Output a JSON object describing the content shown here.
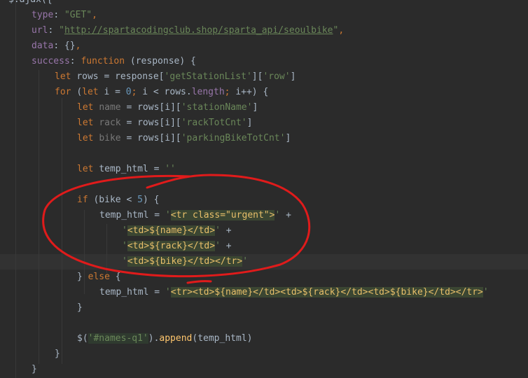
{
  "editor": {
    "lines": [
      {
        "tokens": [
          [
            "$.ajax({",
            "t-plain"
          ]
        ]
      },
      {
        "tokens": [
          [
            "type",
            "t-prop"
          ],
          [
            ": ",
            "t-plain"
          ],
          [
            "\"GET\"",
            "t-str"
          ],
          [
            ",",
            "t-kw"
          ]
        ]
      },
      {
        "tokens": [
          [
            "url",
            "t-prop"
          ],
          [
            ": ",
            "t-plain"
          ],
          [
            "\"",
            "t-str"
          ],
          [
            "http://spartacodingclub.shop/sparta_api/seoulbike",
            "t-url"
          ],
          [
            "\"",
            "t-str"
          ],
          [
            ",",
            "t-kw"
          ]
        ]
      },
      {
        "tokens": [
          [
            "data",
            "t-prop"
          ],
          [
            ": {}",
            "t-plain"
          ],
          [
            ",",
            "t-kw"
          ]
        ]
      },
      {
        "tokens": [
          [
            "success",
            "t-prop"
          ],
          [
            ": ",
            "t-plain"
          ],
          [
            "function",
            "t-kw"
          ],
          [
            " (response) {",
            "t-plain"
          ]
        ]
      },
      {
        "tokens": [
          [
            "let ",
            "t-kw"
          ],
          [
            "rows = response[",
            "t-plain"
          ],
          [
            "'getStationList'",
            "t-str"
          ],
          [
            "][",
            "t-plain"
          ],
          [
            "'row'",
            "t-str"
          ],
          [
            "]",
            "t-plain"
          ]
        ]
      },
      {
        "tokens": [
          [
            "for ",
            "t-kw"
          ],
          [
            "(",
            "t-plain"
          ],
          [
            "let ",
            "t-kw"
          ],
          [
            "i = ",
            "t-plain"
          ],
          [
            "0",
            "t-num"
          ],
          [
            "; ",
            "t-kw"
          ],
          [
            "i < rows.",
            "t-plain"
          ],
          [
            "length",
            "t-prop"
          ],
          [
            "; ",
            "t-kw"
          ],
          [
            "i++) {",
            "t-plain"
          ]
        ]
      },
      {
        "tokens": [
          [
            "let ",
            "t-kw"
          ],
          [
            "name",
            "t-muted"
          ],
          [
            " = rows[i][",
            "t-plain"
          ],
          [
            "'stationName'",
            "t-str"
          ],
          [
            "]",
            "t-plain"
          ]
        ]
      },
      {
        "tokens": [
          [
            "let ",
            "t-kw"
          ],
          [
            "rack",
            "t-muted"
          ],
          [
            " = rows[i][",
            "t-plain"
          ],
          [
            "'rackTotCnt'",
            "t-str"
          ],
          [
            "]",
            "t-plain"
          ]
        ]
      },
      {
        "tokens": [
          [
            "let ",
            "t-kw"
          ],
          [
            "bike",
            "t-muted"
          ],
          [
            " = rows[i][",
            "t-plain"
          ],
          [
            "'parkingBikeTotCnt'",
            "t-str"
          ],
          [
            "]",
            "t-plain"
          ]
        ]
      },
      {
        "tokens": []
      },
      {
        "tokens": [
          [
            "let ",
            "t-kw"
          ],
          [
            "temp_html = ",
            "t-plain"
          ],
          [
            "''",
            "t-str"
          ]
        ]
      },
      {
        "tokens": []
      },
      {
        "tokens": [
          [
            "if ",
            "t-kw"
          ],
          [
            "(bike < ",
            "t-plain"
          ],
          [
            "5",
            "t-num"
          ],
          [
            ") {",
            "t-plain"
          ]
        ]
      },
      {
        "tokens": [
          [
            "temp_html = ",
            "t-plain"
          ],
          [
            "'",
            "t-str"
          ],
          [
            "<tr class=\"urgent\">",
            "t-html-hl"
          ],
          [
            "'",
            "t-str"
          ],
          [
            " +",
            "t-plain"
          ]
        ]
      },
      {
        "tokens": [
          [
            "'",
            "t-str"
          ],
          [
            "<td>${name}</td>",
            "t-html-hl"
          ],
          [
            "'",
            "t-str"
          ],
          [
            " +",
            "t-plain"
          ]
        ]
      },
      {
        "tokens": [
          [
            "'",
            "t-str"
          ],
          [
            "<td>${rack}</td>",
            "t-html-hl"
          ],
          [
            "'",
            "t-str"
          ],
          [
            " +",
            "t-plain"
          ]
        ]
      },
      {
        "tokens": [
          [
            "'",
            "t-str"
          ],
          [
            "<td>${bike}</td></tr>",
            "t-html-hl"
          ],
          [
            "'",
            "t-str"
          ]
        ]
      },
      {
        "tokens": [
          [
            "} ",
            "t-plain"
          ],
          [
            "else ",
            "t-kw"
          ],
          [
            "{",
            "t-plain"
          ]
        ]
      },
      {
        "tokens": [
          [
            "temp_html = ",
            "t-plain"
          ],
          [
            "'",
            "t-str"
          ],
          [
            "<tr><td>${name}</td><td>${rack}</td><td>${bike}</td></tr>",
            "t-html-hl"
          ],
          [
            "'",
            "t-str"
          ]
        ]
      },
      {
        "tokens": [
          [
            "}",
            "t-plain"
          ]
        ]
      },
      {
        "tokens": []
      },
      {
        "tokens": [
          [
            "$(",
            "t-plain"
          ],
          [
            "'#names-q1'",
            "t-str-hl"
          ],
          [
            ").",
            "t-plain"
          ],
          [
            "append",
            "t-fn"
          ],
          [
            "(temp_html)",
            "t-plain"
          ]
        ]
      },
      {
        "tokens": [
          [
            "}",
            "t-plain"
          ]
        ]
      },
      {
        "tokens": [
          [
            "}",
            "t-plain"
          ]
        ]
      }
    ]
  },
  "colors": {
    "background": "#2b2b2b",
    "keyword": "#cc7832",
    "string": "#6a8759",
    "property": "#9876aa",
    "number": "#6897bb",
    "function": "#ffc66d",
    "annotation_ink": "#e01b1b"
  }
}
